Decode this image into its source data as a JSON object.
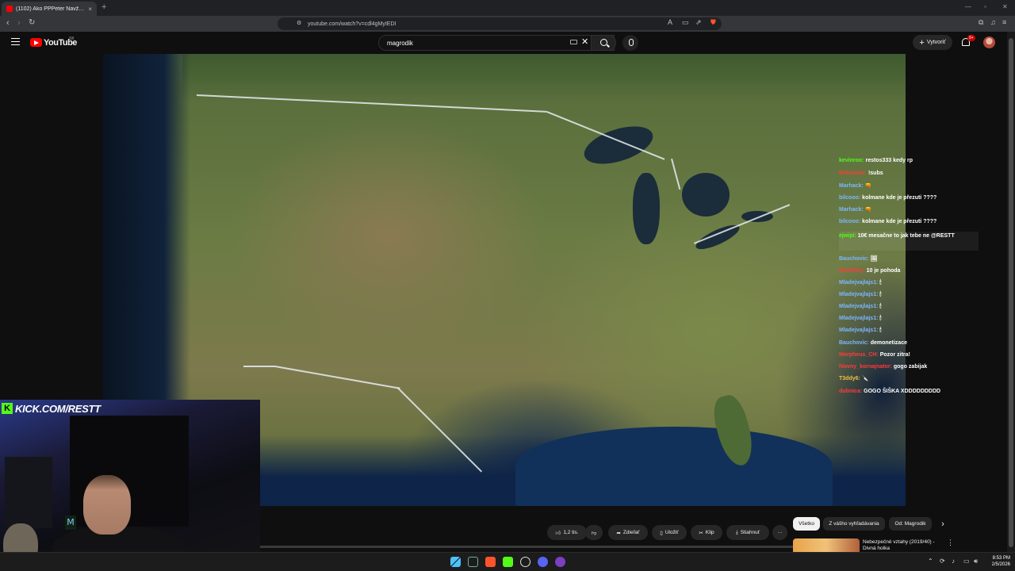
{
  "browser": {
    "tab_title": "(1102) Ako PPPeter Navždy Z",
    "tab_close": "×",
    "new_tab": "+",
    "url": "youtube.com/watch?v=cdl4gMyIEDI"
  },
  "youtube": {
    "logo_text": "YouTube",
    "country_code": "SK",
    "search_value": "magrodik",
    "clear_glyph": "✕",
    "create_label": "Vytvoriť",
    "create_glyph": "+",
    "notification_count": "9+"
  },
  "overlay": {
    "kick_letter": "K",
    "kick_text": "KICK.COM/RESTT"
  },
  "chat": [
    {
      "user": "kevinroo:",
      "text": "restos333 kedy rp",
      "color": "#53fc18"
    },
    {
      "user": "Bolooooo:",
      "text": "!subs",
      "color": "#ff3b3b"
    },
    {
      "user": "Marhack:",
      "text": "🔫",
      "color": "#7ab8ff"
    },
    {
      "user": "bilcooo:",
      "text": "kolmane kde je přezuti ????",
      "color": "#7ab8ff"
    },
    {
      "user": "Marhack:",
      "text": "🔫",
      "color": "#7ab8ff"
    },
    {
      "user": "bilcooo:",
      "text": "kolmane kde je přezuti ????",
      "color": "#7ab8ff"
    },
    {
      "user": "ejwipi:",
      "text": "10€ mesačne to jak tebe ne @RESTT",
      "color": "#53fc18"
    },
    {
      "user": "Bauchovic:",
      "text": "🖼",
      "color": "#7ab8ff"
    },
    {
      "user": "DonPoky:",
      "text": "10 je pohoda",
      "color": "#ff3b3b"
    },
    {
      "user": "Mladejvajlajs1:",
      "text": "🕯",
      "color": "#7ab8ff"
    },
    {
      "user": "Mladejvajlajs1:",
      "text": "🕯",
      "color": "#7ab8ff"
    },
    {
      "user": "Mladejvajlajs1:",
      "text": "🕯",
      "color": "#7ab8ff"
    },
    {
      "user": "Mladejvajlajs1:",
      "text": "🕯",
      "color": "#7ab8ff"
    },
    {
      "user": "Mladejvajlajs1:",
      "text": "🕯",
      "color": "#7ab8ff"
    },
    {
      "user": "Bauchovic:",
      "text": "demonetizace",
      "color": "#7ab8ff"
    },
    {
      "user": "Morpheus_CH:",
      "text": "Pozor zitra!",
      "color": "#ff3b3b"
    },
    {
      "user": "hlavny_kornajnator:",
      "text": "gogo zabijak",
      "color": "#ff3b3b"
    },
    {
      "user": "T3ddy6:",
      "text": "🔪",
      "color": "#f0c040"
    },
    {
      "user": "dubnica:",
      "text": "GOGO ŠIŠKA XDDDDDDDDD",
      "color": "#ff3b3b"
    }
  ],
  "actions": {
    "likes": "1,2 tis.",
    "share": "Zdieľať",
    "save": "Uložiť",
    "clip": "Klip",
    "download": "Stiahnuť",
    "more": "···"
  },
  "chips": [
    "Všetko",
    "Z vášho vyhľadávania",
    "Od: Magrodik"
  ],
  "chips_next": "›",
  "recommendation": {
    "title": "Nebezpečné vztahy (2019/40) - Divná holka"
  },
  "taskbar": {
    "time": "8:53 PM",
    "date": "2/5/2026"
  },
  "colors": {
    "youtube_red": "#ff0000",
    "kick_green": "#53fc18",
    "background": "#0f0f0f"
  }
}
